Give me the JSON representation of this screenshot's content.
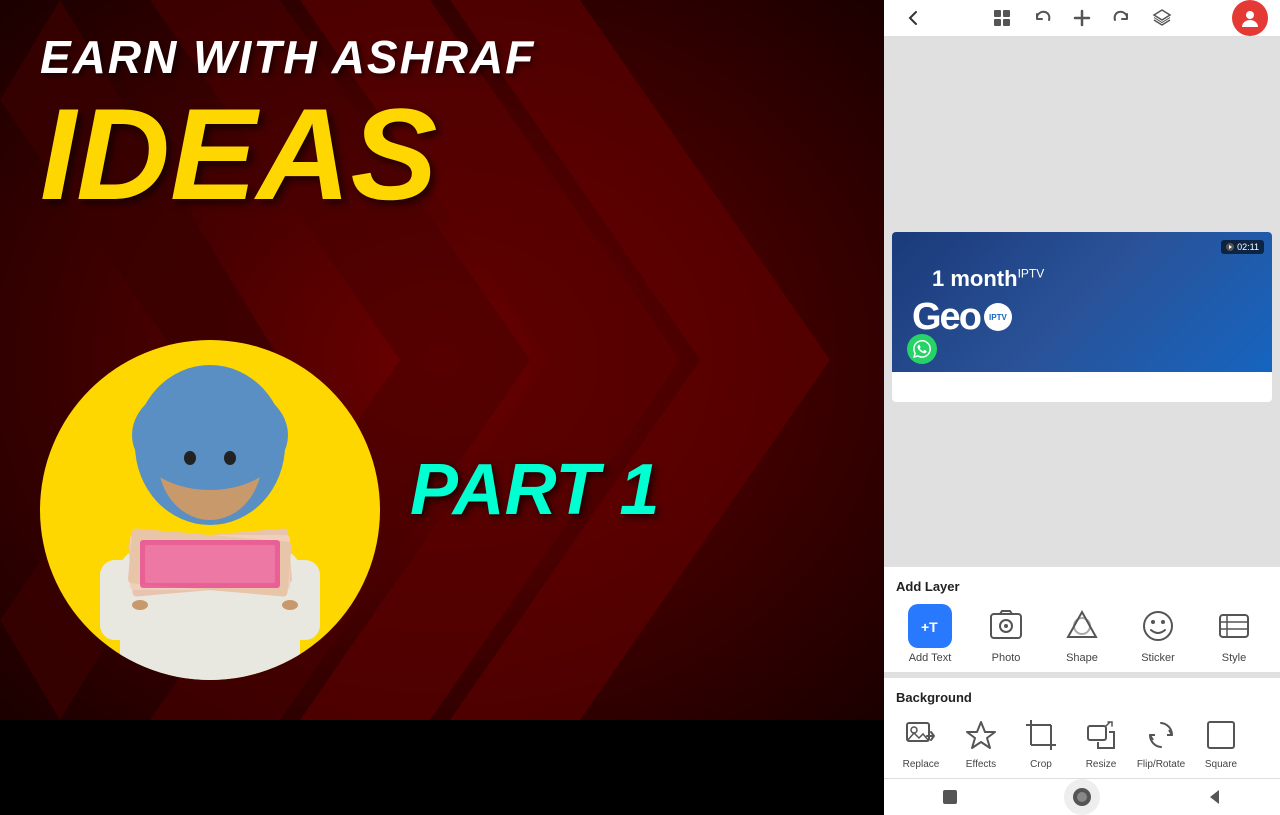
{
  "canvas": {
    "earn_text": "EARN WITH ASHRAF",
    "ideas_text": "IDEAS",
    "part_text": "PART 1"
  },
  "toolbar": {
    "back_label": "←",
    "grid_label": "⊞",
    "undo_label": "↩",
    "add_label": "+",
    "redo_label": "↪",
    "layers_label": "◧",
    "profile_label": "●"
  },
  "card": {
    "line1": "1 month",
    "line1_sup": "IPTV",
    "geo_label": "Geo",
    "iptv_badge": "IPTV",
    "duration": "02:11"
  },
  "add_layer": {
    "title": "Add Layer",
    "tools": [
      {
        "id": "add-text",
        "label": "Add Text",
        "icon": "+T"
      },
      {
        "id": "photo",
        "label": "Photo",
        "icon": "🖼"
      },
      {
        "id": "shape",
        "label": "Shape",
        "icon": "◆"
      },
      {
        "id": "sticker",
        "label": "Sticker",
        "icon": "☺"
      },
      {
        "id": "style",
        "label": "Style",
        "icon": "▤"
      }
    ]
  },
  "background": {
    "title": "Background",
    "tools": [
      {
        "id": "replace",
        "label": "Replace",
        "icon": "replace"
      },
      {
        "id": "effects",
        "label": "Effects",
        "icon": "effects"
      },
      {
        "id": "crop",
        "label": "Crop",
        "icon": "crop"
      },
      {
        "id": "resize",
        "label": "Resize",
        "icon": "resize"
      },
      {
        "id": "flip-rotate",
        "label": "Flip/Rotate",
        "icon": "flip"
      },
      {
        "id": "square",
        "label": "Square",
        "icon": "square"
      }
    ]
  },
  "bottom_nav": {
    "items": [
      {
        "id": "stop",
        "icon": "■"
      },
      {
        "id": "play",
        "icon": "●"
      },
      {
        "id": "back",
        "icon": "◀"
      }
    ]
  }
}
